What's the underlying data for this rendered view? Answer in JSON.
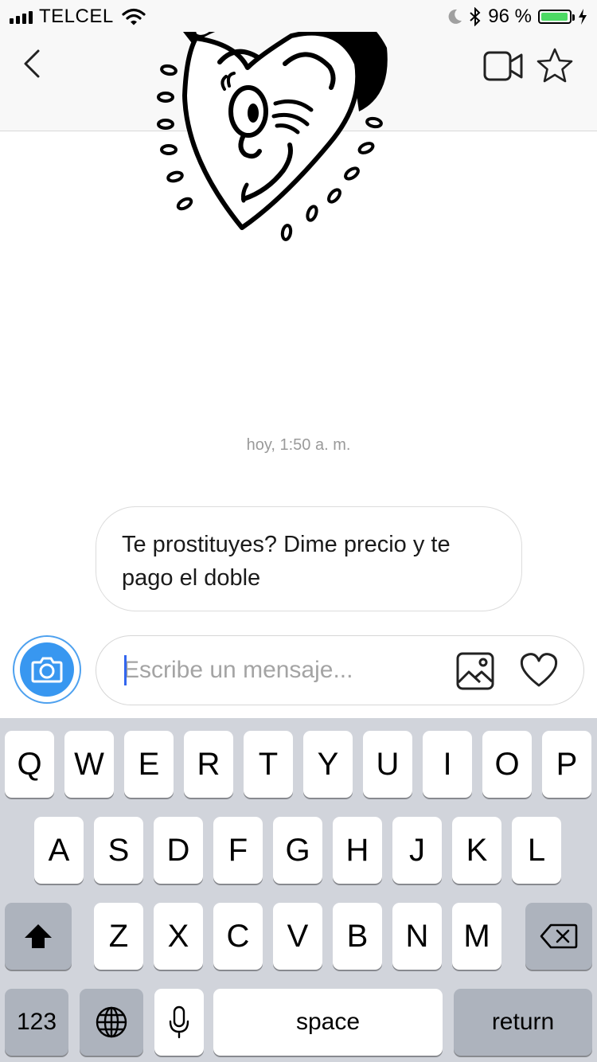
{
  "status_bar": {
    "carrier": "TELCEL",
    "battery_percent": "96 %",
    "battery_level": 0.96,
    "battery_color": "#4cd964",
    "icons": [
      "signal-bars-icon",
      "wifi-icon",
      "moon-icon",
      "bluetooth-icon",
      "battery-icon",
      "charging-bolt-icon"
    ]
  },
  "nav": {
    "icons": [
      "back-chevron-icon",
      "video-camera-icon",
      "star-icon"
    ]
  },
  "chat": {
    "timestamp": "hoy, 1:50 a. m.",
    "messages": [
      {
        "text": "Te prostituyes? Dime precio y te pago el doble"
      }
    ]
  },
  "composer": {
    "placeholder": "Escribe un mensaje...",
    "value": "",
    "accent_color": "#3897f0",
    "icons": [
      "camera-icon",
      "gallery-icon",
      "heart-icon"
    ]
  },
  "keyboard": {
    "row1": [
      "Q",
      "W",
      "E",
      "R",
      "T",
      "Y",
      "U",
      "I",
      "O",
      "P"
    ],
    "row2": [
      "A",
      "S",
      "D",
      "F",
      "G",
      "H",
      "J",
      "K",
      "L"
    ],
    "row3": [
      "Z",
      "X",
      "C",
      "V",
      "B",
      "N",
      "M"
    ],
    "numbers_label": "123",
    "space_label": "space",
    "return_label": "return",
    "icons": [
      "shift-icon",
      "backspace-icon",
      "globe-icon",
      "microphone-icon"
    ]
  }
}
